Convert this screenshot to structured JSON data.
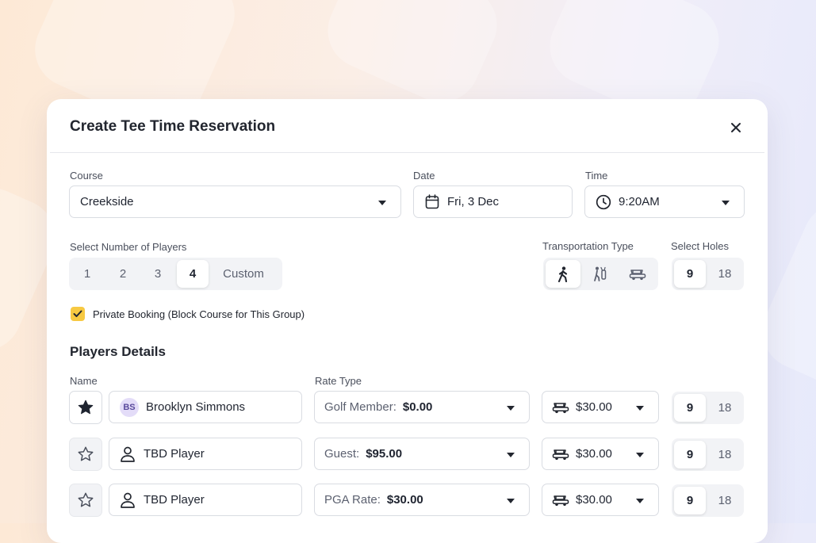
{
  "modal": {
    "title": "Create Tee Time Reservation"
  },
  "course": {
    "label": "Course",
    "value": "Creekside"
  },
  "date": {
    "label": "Date",
    "value": "Fri, 3 Dec"
  },
  "time": {
    "label": "Time",
    "value": "9:20AM"
  },
  "players_select": {
    "label": "Select Number of Players",
    "options": [
      "1",
      "2",
      "3",
      "4",
      "Custom"
    ],
    "selected": "4"
  },
  "transport": {
    "label": "Transportation Type",
    "options": [
      "walking-icon",
      "golf-bag-icon",
      "golf-cart-icon"
    ],
    "selected": "walking-icon"
  },
  "holes": {
    "label": "Select Holes",
    "options": [
      "9",
      "18"
    ],
    "selected": "9"
  },
  "private_booking": {
    "label": "Private Booking (Block Course for This Group)",
    "checked": true
  },
  "players_details": {
    "title": "Players Details",
    "name_header": "Name",
    "rate_header": "Rate Type",
    "rows": [
      {
        "starred": true,
        "initials": "BS",
        "name": "Brooklyn Simmons",
        "rate_label": "Golf Member:",
        "rate_value": "$0.00",
        "cart_price": "$30.00",
        "holes": [
          "9",
          "18"
        ],
        "holes_selected": "9"
      },
      {
        "starred": false,
        "initials": "",
        "name": "TBD Player",
        "rate_label": "Guest:",
        "rate_value": "$95.00",
        "cart_price": "$30.00",
        "holes": [
          "9",
          "18"
        ],
        "holes_selected": "9"
      },
      {
        "starred": false,
        "initials": "",
        "name": "TBD Player",
        "rate_label": "PGA Rate:",
        "rate_value": "$30.00",
        "cart_price": "$30.00",
        "holes": [
          "9",
          "18"
        ],
        "holes_selected": "9"
      }
    ]
  },
  "colors": {
    "accent": "#f7c942",
    "avatar_bg": "#e3dcf8",
    "segment_bg": "#f2f3f6"
  }
}
